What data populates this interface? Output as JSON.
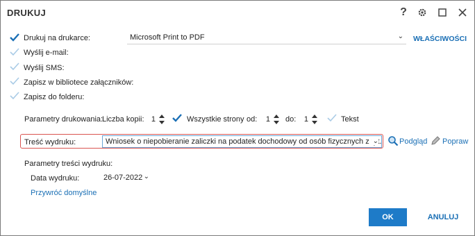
{
  "window": {
    "title": "DRUKUJ"
  },
  "titlebar_icons": {
    "help": "?",
    "settings": "gear-icon",
    "maximize": "maximize-icon",
    "close": "close-icon"
  },
  "outputs": [
    {
      "label": "Drukuj na drukarce:",
      "checked": true
    },
    {
      "label": "Wyślij e-mail:",
      "checked": false
    },
    {
      "label": "Wyślij SMS:",
      "checked": false
    },
    {
      "label": "Zapisz w bibliotece załączników:",
      "checked": false
    },
    {
      "label": "Zapisz do folderu:",
      "checked": false
    }
  ],
  "printer": {
    "selected": "Microsoft Print to PDF",
    "properties_label": "WŁAŚCIWOŚCI"
  },
  "print_params": {
    "label": "Parametry drukowania:",
    "copies_label": "Liczba kopii:",
    "copies_value": "1",
    "all_pages_label": "Wszystkie strony",
    "all_pages_checked": true,
    "from_label": "od:",
    "from_value": "1",
    "to_label": "do:",
    "to_value": "1",
    "text_label": "Tekst",
    "text_checked": false
  },
  "content": {
    "label": "Treść wydruku:",
    "selected": "Wniosek o niepobieranie zaliczki na podatek dochodowy od osób fizycznych z tyt. u...",
    "preview_label": "Podgląd",
    "edit_label": "Popraw"
  },
  "content_params": {
    "label": "Parametry treści wydruku:",
    "date_label": "Data wydruku:",
    "date_value": "26-07-2022",
    "restore_defaults": "Przywróć domyślne"
  },
  "footer": {
    "ok": "OK",
    "cancel": "ANULUJ"
  },
  "colors": {
    "accent": "#1e7bc8",
    "check": "#1a6fb5",
    "check_inactive": "#a9cbe6",
    "highlight": "#d9534f"
  }
}
